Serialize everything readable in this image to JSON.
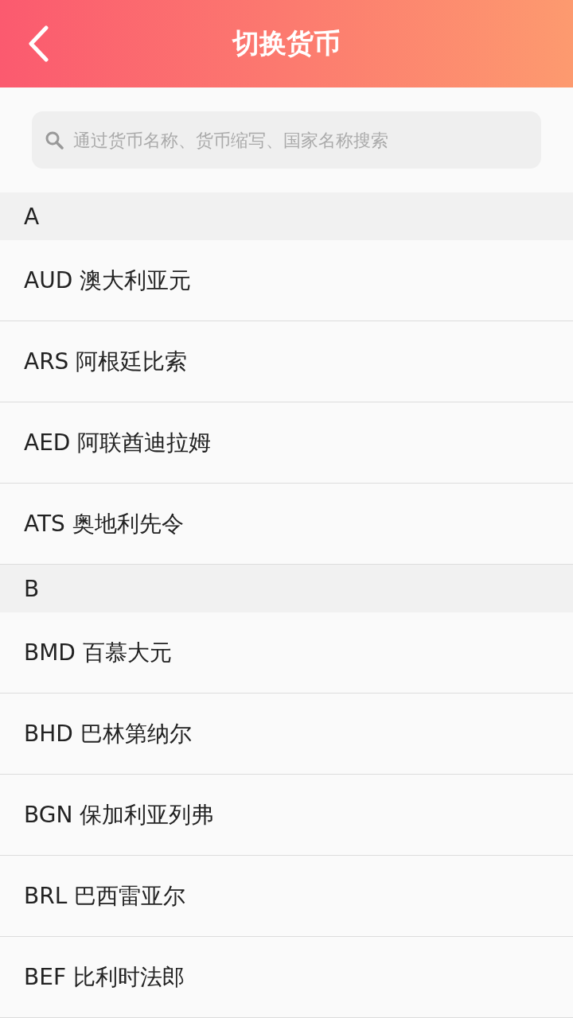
{
  "header": {
    "title": "切换货币"
  },
  "search": {
    "placeholder": "通过货币名称、货币缩写、国家名称搜索"
  },
  "sections": [
    {
      "letter": "A",
      "items": [
        {
          "label": "AUD 澳大利亚元"
        },
        {
          "label": "ARS 阿根廷比索"
        },
        {
          "label": "AED 阿联酋迪拉姆"
        },
        {
          "label": "ATS 奥地利先令"
        }
      ]
    },
    {
      "letter": "B",
      "items": [
        {
          "label": "BMD 百慕大元"
        },
        {
          "label": "BHD 巴林第纳尔"
        },
        {
          "label": "BGN 保加利亚列弗"
        },
        {
          "label": "BRL 巴西雷亚尔"
        },
        {
          "label": "BEF 比利时法郎"
        }
      ]
    }
  ]
}
